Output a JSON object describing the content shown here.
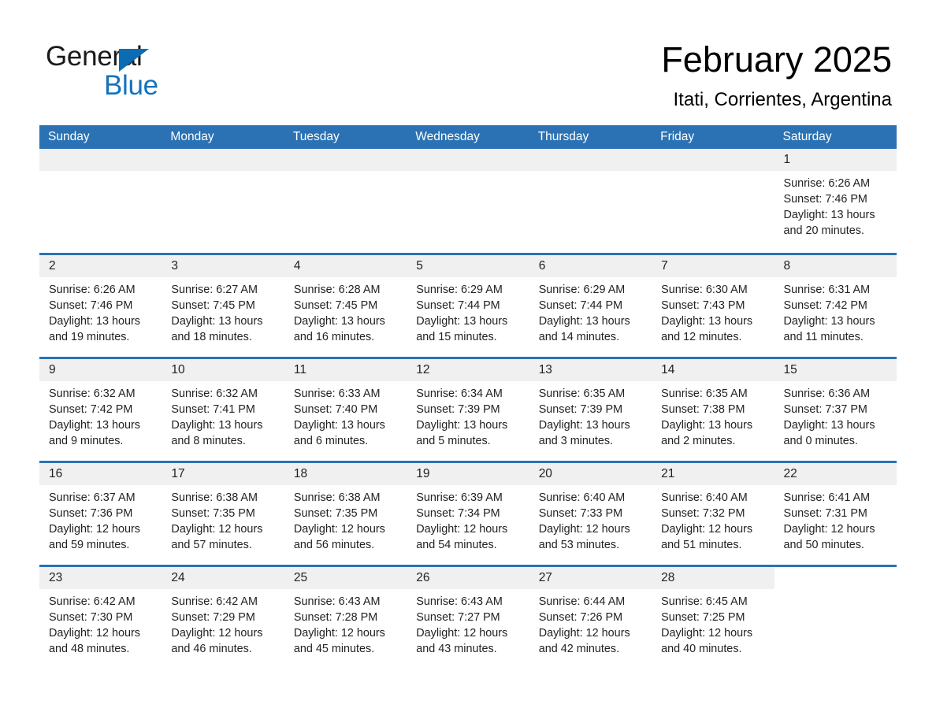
{
  "brand": {
    "word_one": "General",
    "word_two": "Blue",
    "triangle_icon": "triangle-icon",
    "accent_color": "#1273be"
  },
  "header": {
    "month_title": "February 2025",
    "location": "Itati, Corrientes, Argentina"
  },
  "theme": {
    "header_blue": "#2b72b4",
    "daynum_band": "#f0f0f0",
    "text": "#222222",
    "page_bg": "#ffffff"
  },
  "calendar": {
    "weekday_headers": [
      "Sunday",
      "Monday",
      "Tuesday",
      "Wednesday",
      "Thursday",
      "Friday",
      "Saturday"
    ],
    "labels": {
      "sunrise": "Sunrise:",
      "sunset": "Sunset:",
      "daylight": "Daylight:"
    },
    "weeks": [
      [
        {
          "day": "",
          "lines": []
        },
        {
          "day": "",
          "lines": []
        },
        {
          "day": "",
          "lines": []
        },
        {
          "day": "",
          "lines": []
        },
        {
          "day": "",
          "lines": []
        },
        {
          "day": "",
          "lines": []
        },
        {
          "day": "1",
          "lines": [
            "Sunrise: 6:26 AM",
            "Sunset: 7:46 PM",
            "Daylight: 13 hours and 20 minutes."
          ]
        }
      ],
      [
        {
          "day": "2",
          "lines": [
            "Sunrise: 6:26 AM",
            "Sunset: 7:46 PM",
            "Daylight: 13 hours and 19 minutes."
          ]
        },
        {
          "day": "3",
          "lines": [
            "Sunrise: 6:27 AM",
            "Sunset: 7:45 PM",
            "Daylight: 13 hours and 18 minutes."
          ]
        },
        {
          "day": "4",
          "lines": [
            "Sunrise: 6:28 AM",
            "Sunset: 7:45 PM",
            "Daylight: 13 hours and 16 minutes."
          ]
        },
        {
          "day": "5",
          "lines": [
            "Sunrise: 6:29 AM",
            "Sunset: 7:44 PM",
            "Daylight: 13 hours and 15 minutes."
          ]
        },
        {
          "day": "6",
          "lines": [
            "Sunrise: 6:29 AM",
            "Sunset: 7:44 PM",
            "Daylight: 13 hours and 14 minutes."
          ]
        },
        {
          "day": "7",
          "lines": [
            "Sunrise: 6:30 AM",
            "Sunset: 7:43 PM",
            "Daylight: 13 hours and 12 minutes."
          ]
        },
        {
          "day": "8",
          "lines": [
            "Sunrise: 6:31 AM",
            "Sunset: 7:42 PM",
            "Daylight: 13 hours and 11 minutes."
          ]
        }
      ],
      [
        {
          "day": "9",
          "lines": [
            "Sunrise: 6:32 AM",
            "Sunset: 7:42 PM",
            "Daylight: 13 hours and 9 minutes."
          ]
        },
        {
          "day": "10",
          "lines": [
            "Sunrise: 6:32 AM",
            "Sunset: 7:41 PM",
            "Daylight: 13 hours and 8 minutes."
          ]
        },
        {
          "day": "11",
          "lines": [
            "Sunrise: 6:33 AM",
            "Sunset: 7:40 PM",
            "Daylight: 13 hours and 6 minutes."
          ]
        },
        {
          "day": "12",
          "lines": [
            "Sunrise: 6:34 AM",
            "Sunset: 7:39 PM",
            "Daylight: 13 hours and 5 minutes."
          ]
        },
        {
          "day": "13",
          "lines": [
            "Sunrise: 6:35 AM",
            "Sunset: 7:39 PM",
            "Daylight: 13 hours and 3 minutes."
          ]
        },
        {
          "day": "14",
          "lines": [
            "Sunrise: 6:35 AM",
            "Sunset: 7:38 PM",
            "Daylight: 13 hours and 2 minutes."
          ]
        },
        {
          "day": "15",
          "lines": [
            "Sunrise: 6:36 AM",
            "Sunset: 7:37 PM",
            "Daylight: 13 hours and 0 minutes."
          ]
        }
      ],
      [
        {
          "day": "16",
          "lines": [
            "Sunrise: 6:37 AM",
            "Sunset: 7:36 PM",
            "Daylight: 12 hours and 59 minutes."
          ]
        },
        {
          "day": "17",
          "lines": [
            "Sunrise: 6:38 AM",
            "Sunset: 7:35 PM",
            "Daylight: 12 hours and 57 minutes."
          ]
        },
        {
          "day": "18",
          "lines": [
            "Sunrise: 6:38 AM",
            "Sunset: 7:35 PM",
            "Daylight: 12 hours and 56 minutes."
          ]
        },
        {
          "day": "19",
          "lines": [
            "Sunrise: 6:39 AM",
            "Sunset: 7:34 PM",
            "Daylight: 12 hours and 54 minutes."
          ]
        },
        {
          "day": "20",
          "lines": [
            "Sunrise: 6:40 AM",
            "Sunset: 7:33 PM",
            "Daylight: 12 hours and 53 minutes."
          ]
        },
        {
          "day": "21",
          "lines": [
            "Sunrise: 6:40 AM",
            "Sunset: 7:32 PM",
            "Daylight: 12 hours and 51 minutes."
          ]
        },
        {
          "day": "22",
          "lines": [
            "Sunrise: 6:41 AM",
            "Sunset: 7:31 PM",
            "Daylight: 12 hours and 50 minutes."
          ]
        }
      ],
      [
        {
          "day": "23",
          "lines": [
            "Sunrise: 6:42 AM",
            "Sunset: 7:30 PM",
            "Daylight: 12 hours and 48 minutes."
          ]
        },
        {
          "day": "24",
          "lines": [
            "Sunrise: 6:42 AM",
            "Sunset: 7:29 PM",
            "Daylight: 12 hours and 46 minutes."
          ]
        },
        {
          "day": "25",
          "lines": [
            "Sunrise: 6:43 AM",
            "Sunset: 7:28 PM",
            "Daylight: 12 hours and 45 minutes."
          ]
        },
        {
          "day": "26",
          "lines": [
            "Sunrise: 6:43 AM",
            "Sunset: 7:27 PM",
            "Daylight: 12 hours and 43 minutes."
          ]
        },
        {
          "day": "27",
          "lines": [
            "Sunrise: 6:44 AM",
            "Sunset: 7:26 PM",
            "Daylight: 12 hours and 42 minutes."
          ]
        },
        {
          "day": "28",
          "lines": [
            "Sunrise: 6:45 AM",
            "Sunset: 7:25 PM",
            "Daylight: 12 hours and 40 minutes."
          ]
        },
        {
          "day": "",
          "lines": []
        }
      ]
    ]
  }
}
